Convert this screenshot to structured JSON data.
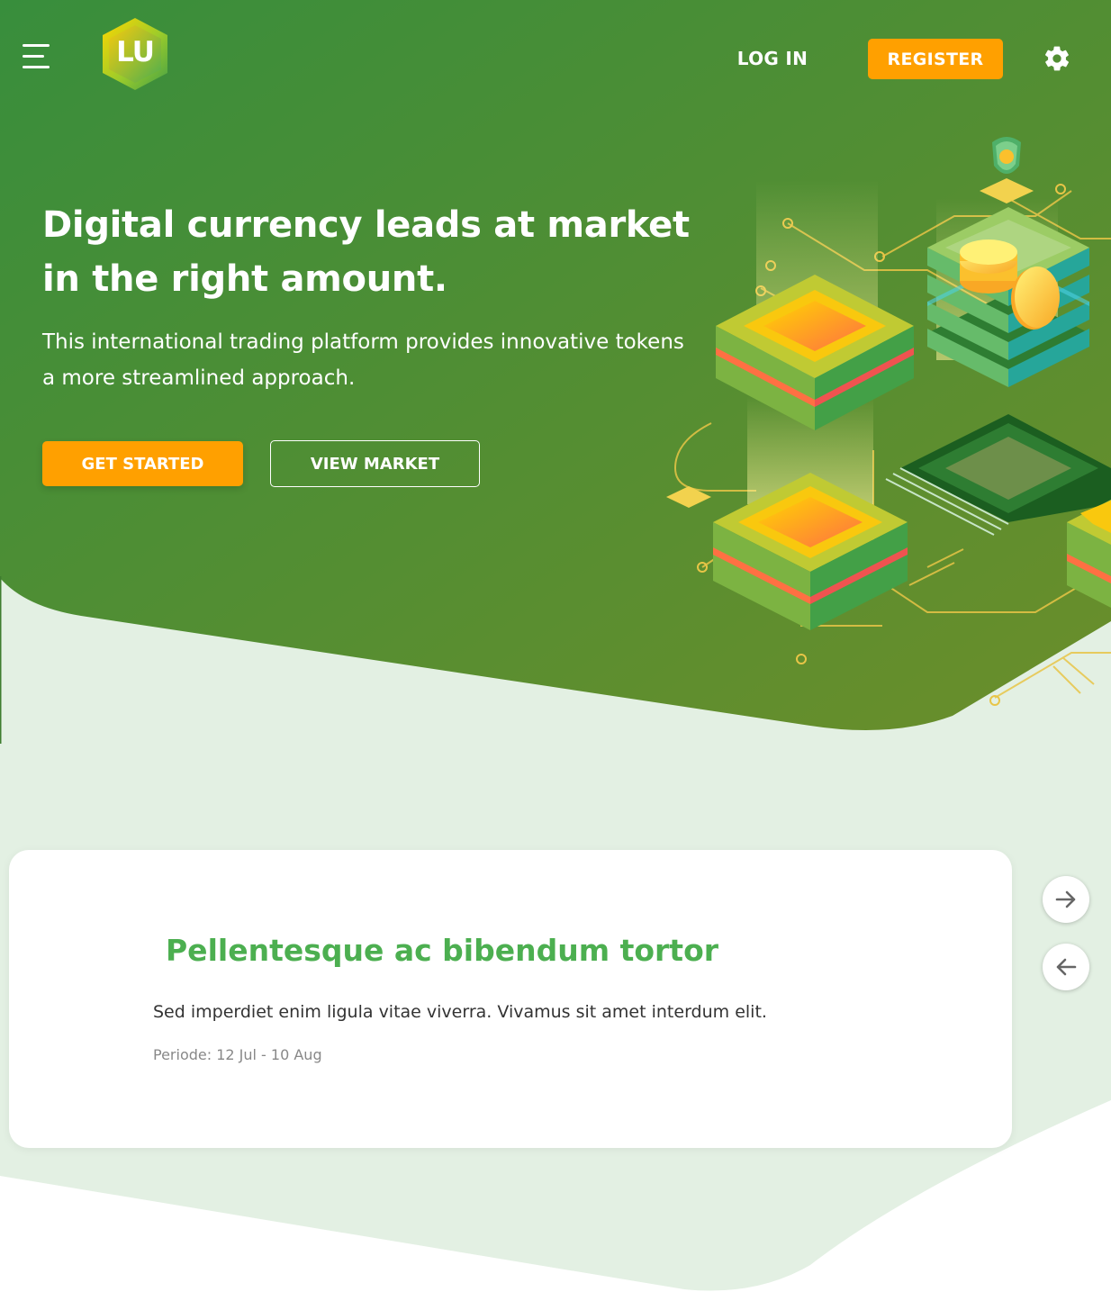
{
  "colors": {
    "hero_gradient_start": "#388e3c",
    "hero_gradient_end": "#6b8e2a",
    "accent_orange": "#ffa000",
    "section_background": "#e3f0e3",
    "card_title_green": "#4caf50"
  },
  "header": {
    "menu_icon": "hamburger-icon",
    "logo_text": "LU",
    "login_label": "LOG IN",
    "register_label": "REGISTER",
    "settings_icon": "gear-icon"
  },
  "hero": {
    "title": "Digital currency leads at market in the right amount.",
    "subtitle": "This international trading platform provides innovative tokens a more streamlined approach.",
    "primary_button": "GET STARTED",
    "secondary_button": "VIEW MARKET",
    "illustration": "isometric-crypto-circuit-illustration"
  },
  "promo_card": {
    "title": "Pellentesque ac bibendum tortor",
    "description": "Sed imperdiet enim ligula vitae viverra. Vivamus sit amet interdum elit.",
    "period_label": "Periode:",
    "period_value": "12 Jul - 10 Aug"
  },
  "carousel": {
    "next_icon": "arrow-right-icon",
    "prev_icon": "arrow-left-icon"
  }
}
